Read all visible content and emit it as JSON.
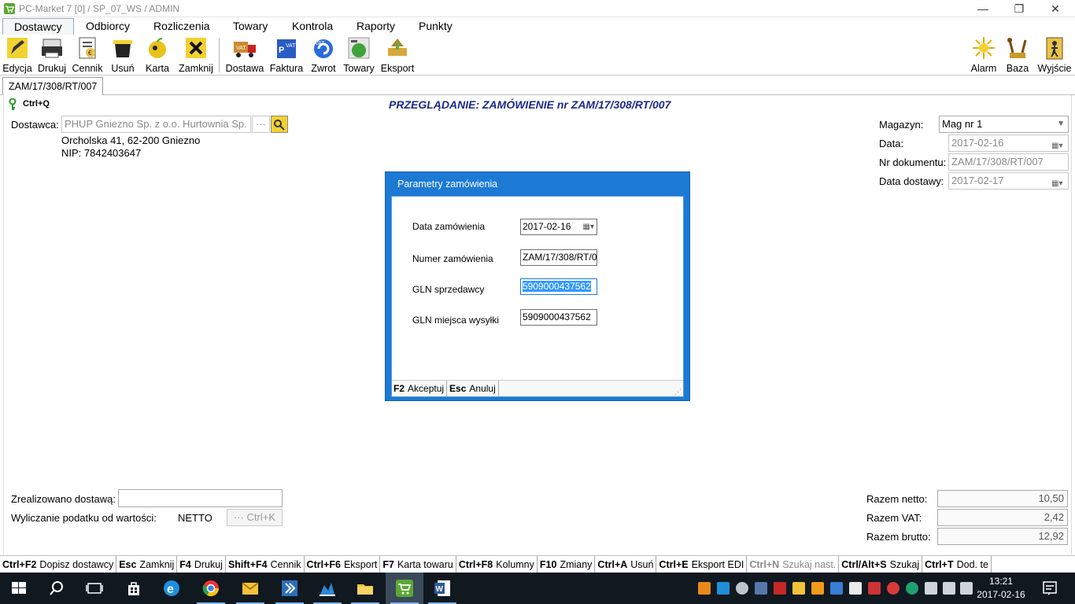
{
  "window": {
    "title": "PC-Market 7 [0] / SP_07_WS / ADMIN",
    "minimize": "—",
    "restore": "❐",
    "close": "✕"
  },
  "menu": [
    "Dostawcy",
    "Odbiorcy",
    "Rozliczenia",
    "Towary",
    "Kontrola",
    "Raporty",
    "Punkty"
  ],
  "toolbar": {
    "items": [
      "Edycja",
      "Drukuj",
      "Cennik",
      "Usuń",
      "Karta",
      "Zamknij",
      "Dostawa",
      "Faktura",
      "Zwrot",
      "Towary",
      "Eksport"
    ],
    "right": [
      "Alarm",
      "Baza",
      "Wyjście"
    ]
  },
  "tab": {
    "label": "ZAM/17/308/RT/007"
  },
  "header": {
    "shortcut": "Ctrl+Q",
    "title": "PRZEGLĄDANIE: ZAMÓWIENIE nr ZAM/17/308/RT/007"
  },
  "supplier": {
    "label": "Dostawca:",
    "name": "PHUP Gniezno Sp. z o.o. Hurtownia Sp.",
    "browse": "···",
    "address": "Orcholska 41, 62-200 Gniezno",
    "nip": "NIP: 7842403647"
  },
  "right_fields": {
    "magazyn_label": "Magazyn:",
    "magazyn": "Mag nr 1",
    "data_label": "Data:",
    "data": "2017-02-16",
    "nr_label": "Nr dokumentu:",
    "nr": "ZAM/17/308/RT/007",
    "dostawa_label": "Data dostawy:",
    "dostawa": "2017-02-17"
  },
  "dialog": {
    "title": "Parametry zamówienia",
    "fields": [
      {
        "label": "Data zamówienia",
        "value": "2017-02-16"
      },
      {
        "label": "Numer zamówienia",
        "value": "ZAM/17/308/RT/0"
      },
      {
        "label": "GLN sprzedawcy",
        "value": "5909000437562"
      },
      {
        "label": "GLN miejsca wysyłki",
        "value": "5909000437562"
      }
    ],
    "accept_key": "F2",
    "accept": "Akceptuj",
    "cancel_key": "Esc",
    "cancel": "Anuluj"
  },
  "bottom_left": {
    "zrealizowano_label": "Zrealizowano dostawą:",
    "zrealizowano": "",
    "podatek_label": "Wyliczanie podatku od wartości:",
    "podatek": "NETTO",
    "ctrlk": "··· Ctrl+K"
  },
  "totals": {
    "netto_label": "Razem netto:",
    "netto": "10,50",
    "vat_label": "Razem VAT:",
    "vat": "2,42",
    "brutto_label": "Razem brutto:",
    "brutto": "12,92"
  },
  "shortcuts": [
    {
      "key": "Ctrl+F2",
      "label": "Dopisz dostawcy"
    },
    {
      "key": "Esc",
      "label": "Zamknij"
    },
    {
      "key": "F4",
      "label": "Drukuj"
    },
    {
      "key": "Shift+F4",
      "label": "Cennik"
    },
    {
      "key": "Ctrl+F6",
      "label": "Eksport"
    },
    {
      "key": "F7",
      "label": "Karta towaru"
    },
    {
      "key": "Ctrl+F8",
      "label": "Kolumny"
    },
    {
      "key": "F10",
      "label": "Zmiany"
    },
    {
      "key": "Ctrl+A",
      "label": "Usuń"
    },
    {
      "key": "Ctrl+E",
      "label": "Eksport EDI"
    },
    {
      "key": "Ctrl+N",
      "label": "Szukaj nast."
    },
    {
      "key": "Ctrl/Alt+S",
      "label": "Szukaj"
    },
    {
      "key": "Ctrl+T",
      "label": "Dod. te"
    }
  ],
  "clock": {
    "time": "13:21",
    "date": "2017-02-16"
  },
  "colors": {
    "dialog": "#1c7ad4",
    "title_blue": "#1b2a8c",
    "taskbar": "#101820"
  }
}
